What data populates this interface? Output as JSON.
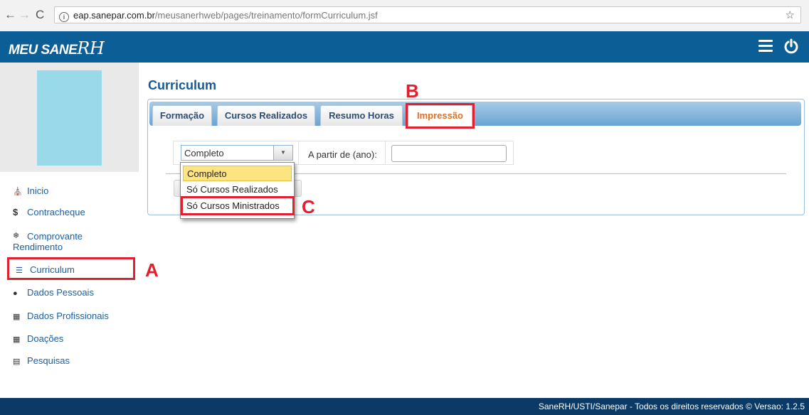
{
  "browser": {
    "url_host": "eap.sanepar.com.br",
    "url_path": "/meusanerhweb/pages/treinamento/formCurriculum.jsf"
  },
  "header": {
    "logo_text": "MEU SANE",
    "logo_rh": "RH"
  },
  "sidebar": {
    "items": [
      {
        "label": "Inicio",
        "icon": "home-icon"
      },
      {
        "label": "Contracheque",
        "icon": "dollar-icon"
      },
      {
        "label": "Comprovante Rendimento",
        "icon": "paw-icon"
      },
      {
        "label": "Curriculum",
        "icon": "graduation-cap-icon"
      },
      {
        "label": "Dados Pessoais",
        "icon": "user-icon"
      },
      {
        "label": "Dados Profissionais",
        "icon": "sitemap-icon"
      },
      {
        "label": "Doações",
        "icon": "gift-icon"
      },
      {
        "label": "Pesquisas",
        "icon": "list-icon"
      }
    ]
  },
  "main": {
    "title": "Curriculum",
    "tabs": [
      "Formação",
      "Cursos Realizados",
      "Resumo Horas",
      "Impressão"
    ],
    "active_tab": "Impressão",
    "select": {
      "value": "Completo",
      "options": [
        "Completo",
        "Só Cursos Realizados",
        "Só Cursos Ministrados"
      ]
    },
    "year_label": "A partir de (ano):",
    "year_value": ""
  },
  "annotations": {
    "a": "A",
    "b": "B",
    "c": "C",
    "color": "#e02030"
  },
  "footer": {
    "text": "SaneRH/USTI/Sanepar - Todos os direitos reservados © Versao: 1.2.5"
  },
  "colors": {
    "header": "#0b5e96",
    "footer": "#0b3a66",
    "active_tab": "#e07020",
    "link": "#1b5fa2"
  }
}
